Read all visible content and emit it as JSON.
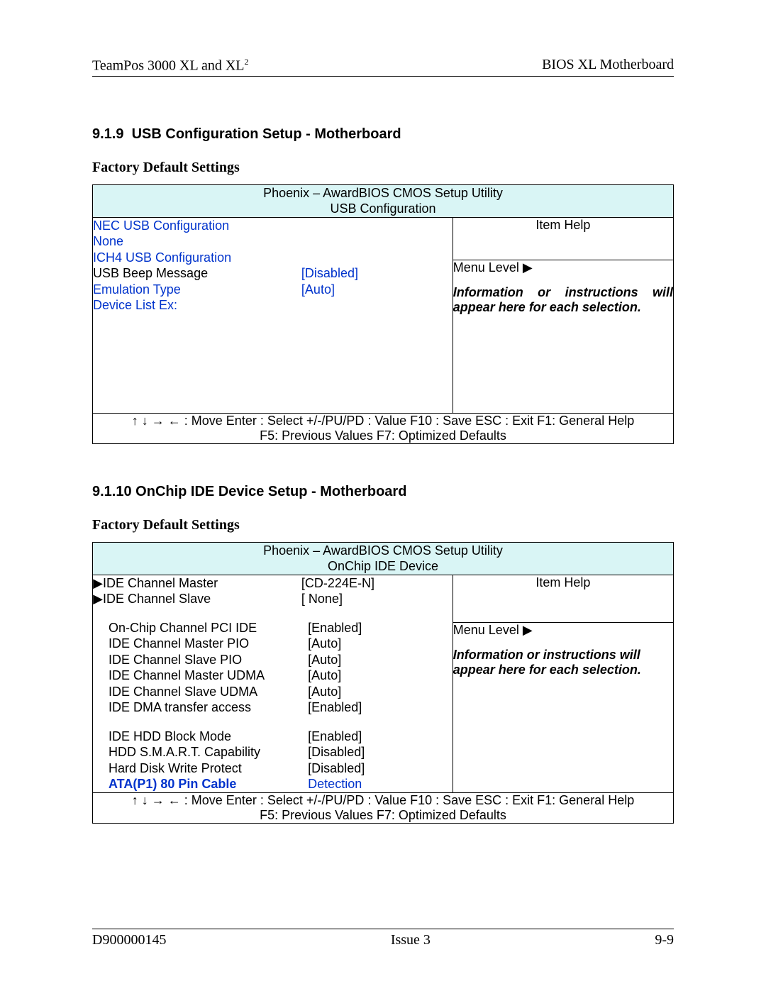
{
  "header": {
    "left_base": "TeamPos 3000 XL and XL",
    "left_sup": "2",
    "right": "BIOS XL Motherboard"
  },
  "section1": {
    "number": "9.1.9",
    "title": "USB Configuration Setup - Motherboard",
    "subheading": "Factory Default Settings",
    "bios_title1": "Phoenix – AwardBIOS CMOS Setup Utility",
    "bios_title2": "USB Configuration",
    "rows": {
      "nec": "NEC USB Configuration",
      "none": "None",
      "ich4": "ICH4 USB Configuration",
      "beep_label": "USB Beep Message",
      "beep_val": "[Disabled]",
      "emul_label": "Emulation Type",
      "emul_val": "[Auto]",
      "devlist": "Device List Ex:"
    },
    "help": {
      "item_help": "Item Help",
      "menu_level": "Menu Level  ▶",
      "desc": "Information or instructions will appear here for each selection."
    }
  },
  "section2": {
    "number": "9.1.10",
    "title": "OnChip IDE Device Setup - Motherboard",
    "subheading": "Factory Default Settings",
    "bios_title1": "Phoenix – AwardBIOS CMOS Setup Utility",
    "bios_title2": "OnChip IDE Device",
    "rows": {
      "ide_master_label": "IDE Channel Master",
      "ide_master_val": "[CD-224E-N]",
      "ide_slave_label": "IDE Channel Slave",
      "ide_slave_val": "[ None]",
      "onchip_label": "On-Chip Channel PCI IDE",
      "onchip_val": "[Enabled]",
      "master_pio_label": "IDE Channel Master PIO",
      "master_pio_val": "[Auto]",
      "slave_pio_label": "IDE Channel Slave PIO",
      "slave_pio_val": "[Auto]",
      "master_udma_label": "IDE Channel Master UDMA",
      "master_udma_val": "[Auto]",
      "slave_udma_label": "IDE Channel Slave UDMA",
      "slave_udma_val": "[Auto]",
      "dma_label": "IDE DMA transfer access",
      "dma_val": "[Enabled]",
      "block_label": "IDE HDD Block Mode",
      "block_val": "[Enabled]",
      "smart_label": "HDD S.M.A.R.T. Capability",
      "smart_val": "[Disabled]",
      "write_label": "Hard Disk Write Protect",
      "write_val": "[Disabled]",
      "ata_label": "ATA(P1) 80 Pin Cable",
      "ata_val": "Detection"
    },
    "help": {
      "item_help": "Item Help",
      "menu_level": "Menu Level  ▶",
      "desc": "Information or instructions will appear here for each selection."
    }
  },
  "keys": {
    "line1": "↑    ↓    →    ←    : Move     Enter : Select     +/-/PU/PD : Value     F10 : Save     ESC : Exit     F1: General Help",
    "line2": "F5: Previous Values                         F7: Optimized Defaults"
  },
  "footer": {
    "left": "D900000145",
    "center": "Issue 3",
    "right": "9-9"
  }
}
